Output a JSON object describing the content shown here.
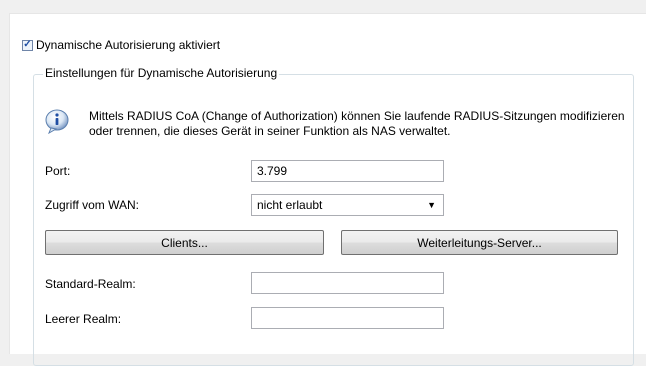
{
  "dynamic_auth": {
    "checked": true,
    "label": "Dynamische Autorisierung aktiviert"
  },
  "settings_group": {
    "title": "Einstellungen für Dynamische Autorisierung",
    "info_icon": "info-icon",
    "info_text": "Mittels RADIUS CoA (Change of Authorization) können Sie laufende RADIUS-Sitzungen modifizieren oder trennen, die dieses Gerät in seiner Funktion als NAS verwaltet."
  },
  "port": {
    "label": "Port:",
    "value": "3.799"
  },
  "wan_access": {
    "label": "Zugriff vom WAN:",
    "value": "nicht erlaubt"
  },
  "buttons": {
    "clients": "Clients...",
    "forwarding": "Weiterleitungs-Server..."
  },
  "standard_realm": {
    "label": "Standard-Realm:",
    "value": ""
  },
  "empty_realm": {
    "label": "Leerer Realm:",
    "value": ""
  }
}
